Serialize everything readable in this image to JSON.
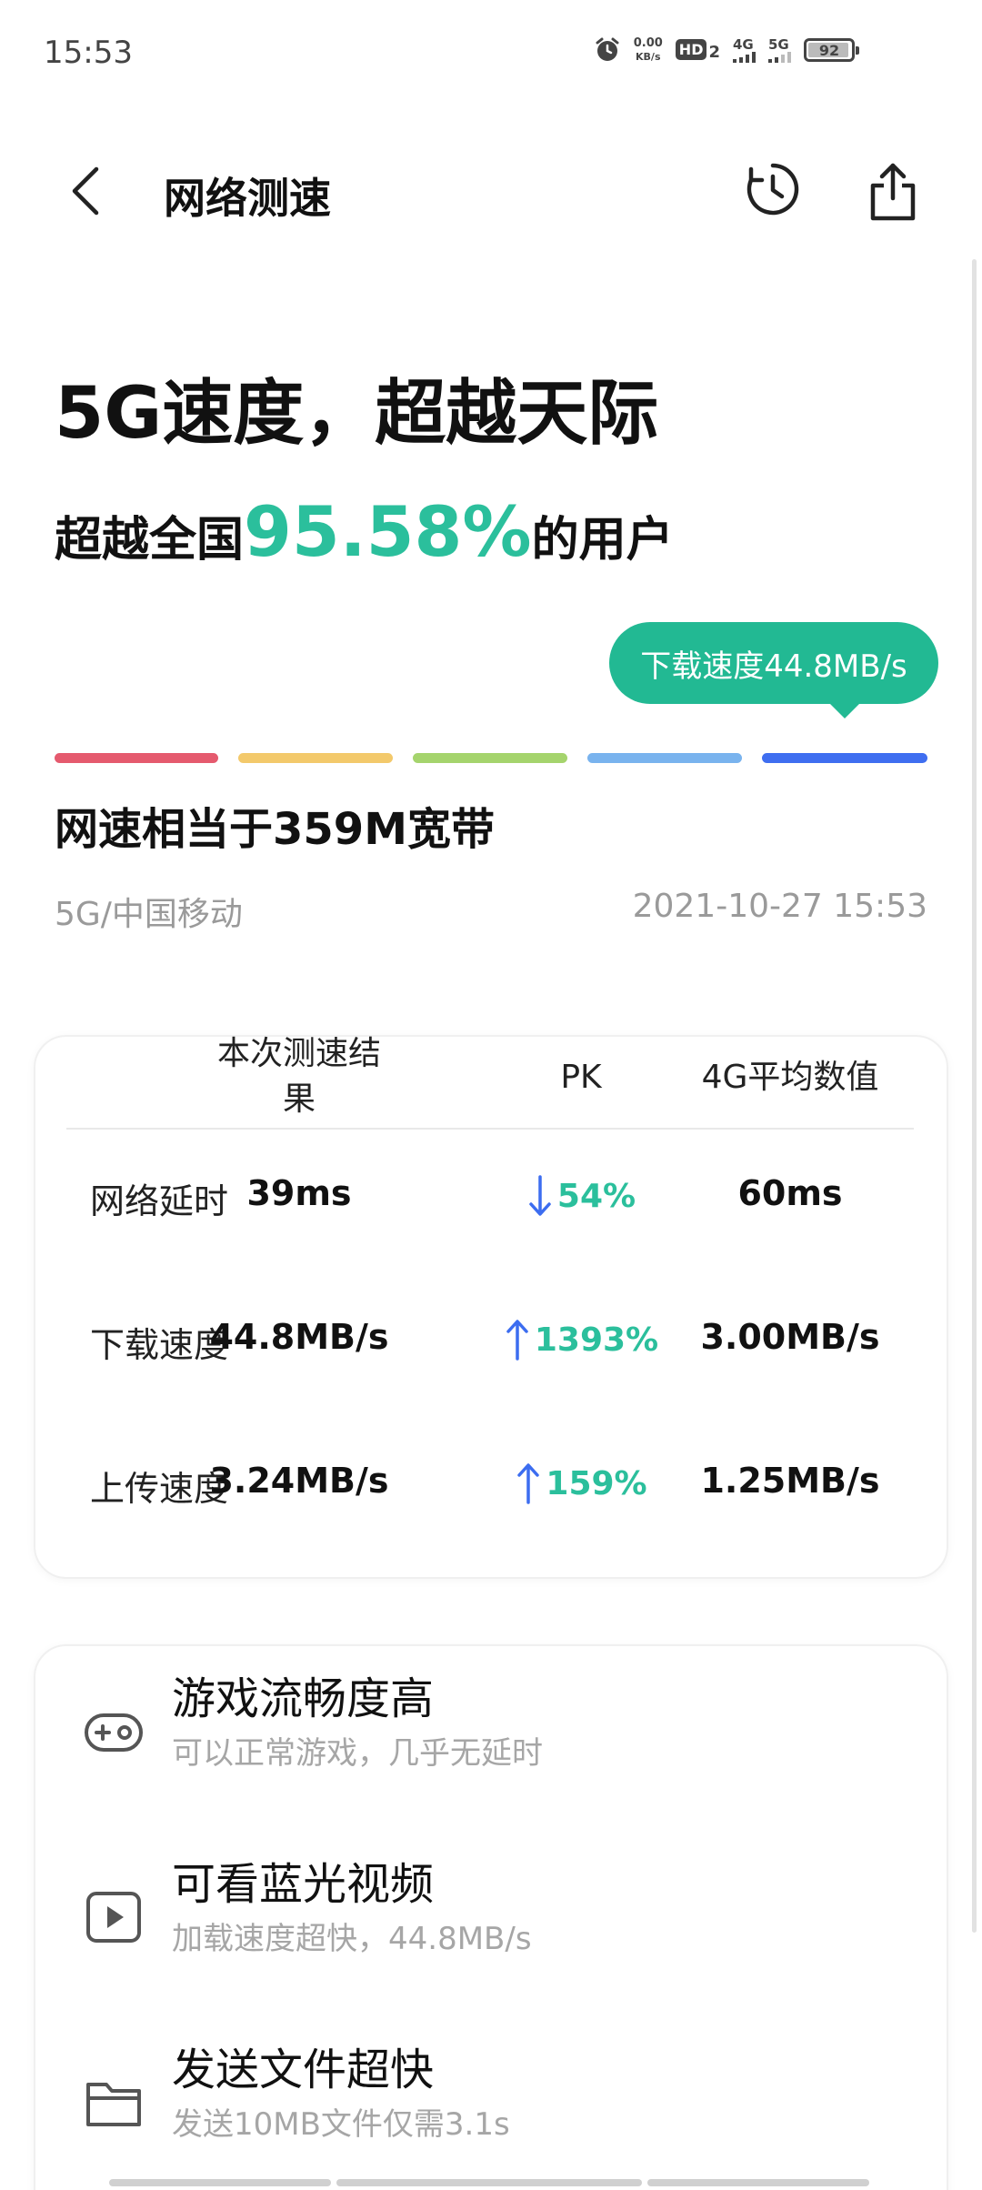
{
  "status_bar": {
    "time": "15:53",
    "net_speed_value": "0.00",
    "net_speed_unit": "KB/s",
    "hd_label": "HD",
    "sim_label": "2",
    "sig1_label": "4G",
    "sig2_label": "5G",
    "battery": "92"
  },
  "header": {
    "title": "网络测速"
  },
  "hero": {
    "headline": "5G速度，超越天际",
    "sub_prefix": "超越全国",
    "sub_percent": "95.58%",
    "sub_suffix": "的用户",
    "tooltip": "下载速度44.8MB/s",
    "equivalent": "网速相当于359M宽带",
    "carrier": "5G/中国移动",
    "timestamp": "2021-10-27 15:53"
  },
  "speed_scale": {
    "colors": [
      "#e55a6e",
      "#f3c96b",
      "#a5d46d",
      "#79b3ee",
      "#3f6ef0"
    ],
    "current_level": 5
  },
  "comparison": {
    "headers": {
      "current": "本次测速结果",
      "current_line1": "本次测速结",
      "current_line2": "果",
      "pk": "PK",
      "avg": "4G平均数值"
    },
    "rows": [
      {
        "label": "网络延时",
        "current": "39ms",
        "pk_dir": "down",
        "pk": "54%",
        "avg": "60ms"
      },
      {
        "label": "下载速度",
        "current": "44.8MB/s",
        "pk_dir": "up",
        "pk": "1393%",
        "avg": "3.00MB/s"
      },
      {
        "label": "上传速度",
        "current": "3.24MB/s",
        "pk_dir": "up",
        "pk": "159%",
        "avg": "1.25MB/s"
      }
    ],
    "arrow_color": "#3c6df0",
    "pk_color": "#2bbf9c"
  },
  "features": [
    {
      "icon": "gamepad-icon",
      "title": "游戏流畅度高",
      "desc": "可以正常游戏，几乎无延时"
    },
    {
      "icon": "video-play-icon",
      "title": "可看蓝光视频",
      "desc": "加载速度超快，44.8MB/s"
    },
    {
      "icon": "folder-icon",
      "title": "发送文件超快",
      "desc": "发送10MB文件仅需3.1s"
    }
  ]
}
